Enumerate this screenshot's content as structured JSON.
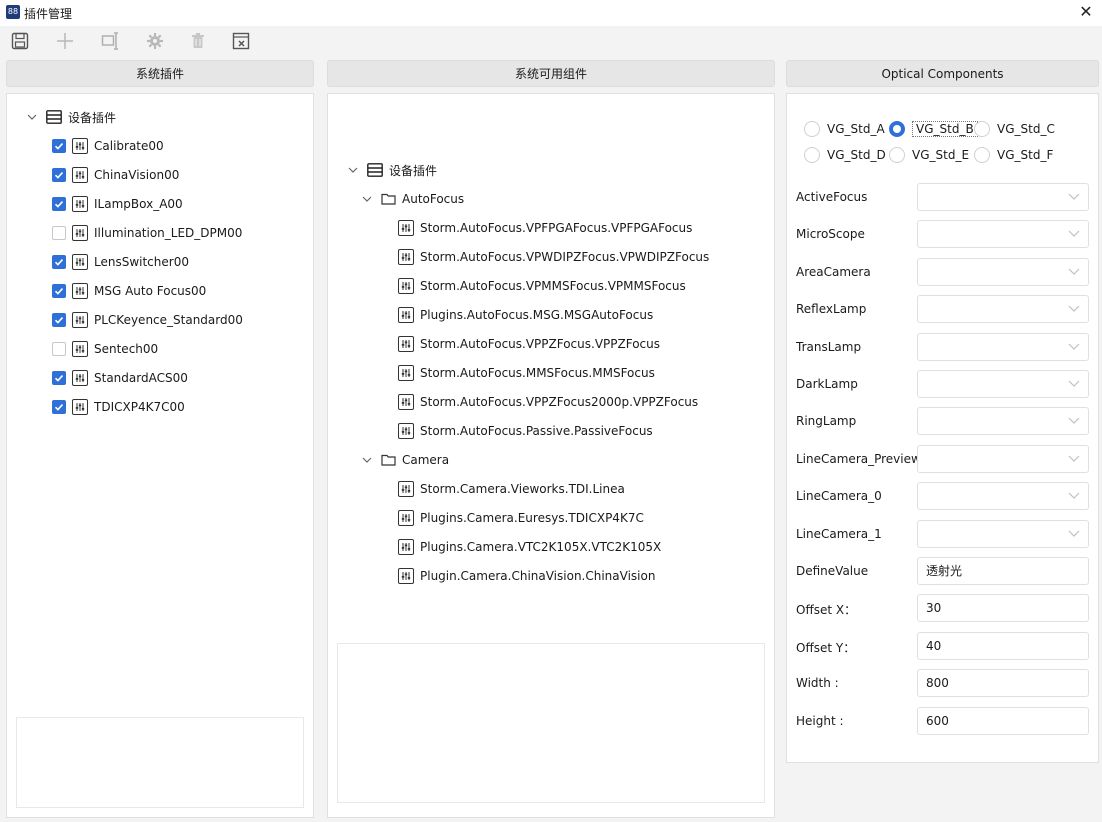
{
  "window": {
    "title": "插件管理",
    "app_icon_text": "88"
  },
  "toolbar": {
    "buttons": [
      {
        "icon": "save-icon"
      },
      {
        "icon": "add-icon"
      },
      {
        "icon": "edit-icon"
      },
      {
        "icon": "gear-icon"
      },
      {
        "icon": "delete-icon"
      },
      {
        "icon": "clear-icon"
      }
    ]
  },
  "headers": {
    "left": "系统插件",
    "middle": "系统可用组件",
    "right": "Optical Components"
  },
  "left_tree": {
    "root": "设备插件",
    "items": [
      {
        "label": "Calibrate00",
        "checked": true
      },
      {
        "label": "ChinaVision00",
        "checked": true
      },
      {
        "label": "ILampBox_A00",
        "checked": true
      },
      {
        "label": "Illumination_LED_DPM00",
        "checked": false
      },
      {
        "label": "LensSwitcher00",
        "checked": true
      },
      {
        "label": "MSG Auto Focus00",
        "checked": true
      },
      {
        "label": "PLCKeyence_Standard00",
        "checked": true
      },
      {
        "label": "Sentech00",
        "checked": false
      },
      {
        "label": "StandardACS00",
        "checked": true
      },
      {
        "label": "TDICXP4K7C00",
        "checked": true
      }
    ]
  },
  "middle_tree": {
    "root": "设备插件",
    "groups": [
      {
        "name": "AutoFocus",
        "items": [
          "Storm.AutoFocus.VPFPGAFocus.VPFPGAFocus",
          "Storm.AutoFocus.VPWDIPZFocus.VPWDIPZFocus",
          "Storm.AutoFocus.VPMMSFocus.VPMMSFocus",
          "Plugins.AutoFocus.MSG.MSGAutoFocus",
          "Storm.AutoFocus.VPPZFocus.VPPZFocus",
          "Storm.AutoFocus.MMSFocus.MMSFocus",
          "Storm.AutoFocus.VPPZFocus2000p.VPPZFocus",
          "Storm.AutoFocus.Passive.PassiveFocus"
        ]
      },
      {
        "name": "Camera",
        "items": [
          "Storm.Camera.Vieworks.TDI.Linea",
          "Plugins.Camera.Euresys.TDICXP4K7C",
          "Plugins.Camera.VTC2K105X.VTC2K105X",
          "Plugin.Camera.ChinaVision.ChinaVision"
        ]
      }
    ]
  },
  "optical": {
    "radios": [
      {
        "label": "VG_Std_A",
        "selected": false
      },
      {
        "label": "VG_Std_B",
        "selected": true
      },
      {
        "label": "VG_Std_C",
        "selected": false
      },
      {
        "label": "VG_Std_D",
        "selected": false
      },
      {
        "label": "VG_Std_E",
        "selected": false
      },
      {
        "label": "VG_Std_F",
        "selected": false
      }
    ],
    "fields": [
      {
        "label": "ActiveFocus",
        "type": "dropdown",
        "value": ""
      },
      {
        "label": "MicroScope",
        "type": "dropdown",
        "value": ""
      },
      {
        "label": "AreaCamera",
        "type": "dropdown",
        "value": ""
      },
      {
        "label": "ReflexLamp",
        "type": "dropdown",
        "value": ""
      },
      {
        "label": "TransLamp",
        "type": "dropdown",
        "value": ""
      },
      {
        "label": "DarkLamp",
        "type": "dropdown",
        "value": ""
      },
      {
        "label": "RingLamp",
        "type": "dropdown",
        "value": ""
      },
      {
        "label": "LineCamera_Preview",
        "type": "dropdown",
        "value": ""
      },
      {
        "label": "LineCamera_0",
        "type": "dropdown",
        "value": ""
      },
      {
        "label": "LineCamera_1",
        "type": "dropdown",
        "value": ""
      },
      {
        "label": "DefineValue",
        "type": "text",
        "value": "透射光"
      },
      {
        "label": "Offset X：",
        "type": "text",
        "value": "30"
      },
      {
        "label": "Offset Y：",
        "type": "text",
        "value": "40"
      },
      {
        "label": "Width :",
        "type": "text",
        "value": "800"
      },
      {
        "label": "Height :",
        "type": "text",
        "value": "600"
      }
    ]
  },
  "colors": {
    "accent": "#2f6fd8",
    "panel": "#ffffff",
    "background": "#f3f3f3"
  }
}
